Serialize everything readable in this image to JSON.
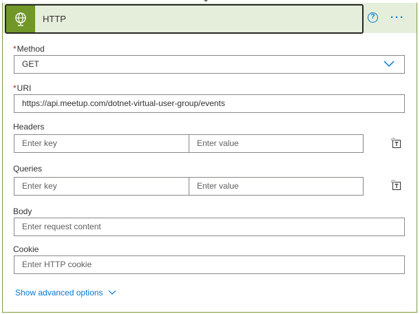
{
  "header": {
    "title": "HTTP",
    "icon": "globe-icon",
    "help_label": "?",
    "more_label": "···",
    "accent": "#709727",
    "link_color": "#0078d4"
  },
  "fields": {
    "method": {
      "label": "Method",
      "required_mark": "*",
      "value": "GET"
    },
    "uri": {
      "label": "URI",
      "required_mark": "*",
      "value": "https://api.meetup.com/dotnet-virtual-user-group/events"
    },
    "headers": {
      "label": "Headers",
      "key_placeholder": "Enter key",
      "value_placeholder": "Enter value"
    },
    "queries": {
      "label": "Queries",
      "key_placeholder": "Enter key",
      "value_placeholder": "Enter value"
    },
    "body": {
      "label": "Body",
      "placeholder": "Enter request content"
    },
    "cookie": {
      "label": "Cookie",
      "placeholder": "Enter HTTP cookie"
    }
  },
  "advanced": {
    "label": "Show advanced options"
  }
}
